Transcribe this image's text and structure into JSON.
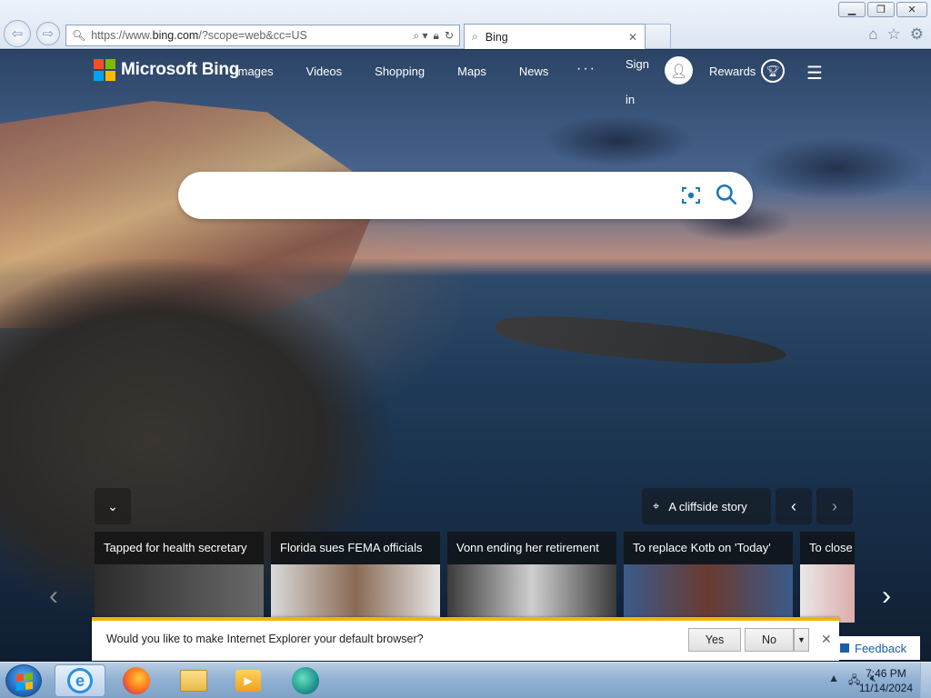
{
  "browser": {
    "url_prefix": "https://www.",
    "url_domain": "bing.com",
    "url_suffix": "/?scope=web&cc=US",
    "tab_title": "Bing",
    "window_buttons": [
      "minimize",
      "restore",
      "close"
    ]
  },
  "bing": {
    "logo_text": "Microsoft Bing",
    "nav": [
      "Images",
      "Videos",
      "Shopping",
      "Maps",
      "News"
    ],
    "more": "···",
    "sign_in": "Sign in",
    "rewards": "Rewards",
    "search_placeholder": "",
    "story_title": "A cliffside story"
  },
  "news": [
    {
      "caption": "Tapped for health secretary",
      "color1": "#2b2b2b",
      "color2": "#6a6a6a"
    },
    {
      "caption": "Florida sues FEMA officials",
      "color1": "#d9d9d9",
      "color2": "#8a6a55"
    },
    {
      "caption": "Vonn ending her retirement",
      "color1": "#3a3a3a",
      "color2": "#cfcfcf"
    },
    {
      "caption": "To replace Kotb on 'Today'",
      "color1": "#3a5a8a",
      "color2": "#6a3a30"
    },
    {
      "caption": "To close",
      "color1": "#e8e8e8",
      "color2": "#c0302a"
    }
  ],
  "notification": {
    "message": "Would you like to make Internet Explorer your default browser?",
    "yes": "Yes",
    "no": "No"
  },
  "feedback": "Feedback",
  "taskbar": {
    "time": "7:46 PM",
    "date": "11/14/2024"
  },
  "colors": {
    "ms_red": "#f25022",
    "ms_green": "#7fba00",
    "ms_blue": "#00a4ef",
    "ms_yellow": "#ffb900",
    "accent": "#1a78b5",
    "notif_bar": "#f3b300"
  }
}
